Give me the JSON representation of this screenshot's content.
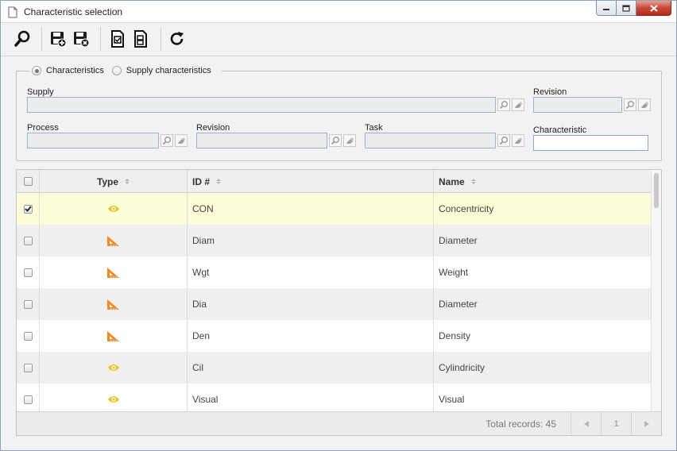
{
  "window": {
    "title": "Characteristic selection",
    "controls": {
      "minimize_icon": "minimize-icon",
      "maximize_icon": "maximize-icon",
      "close_icon": "close-icon"
    }
  },
  "toolbar": {
    "buttons": [
      {
        "name": "search-button",
        "icon": "magnifier-icon"
      },
      {
        "name": "save-add-button",
        "icon": "save-plus-icon"
      },
      {
        "name": "save-close-button",
        "icon": "save-close-icon"
      },
      {
        "name": "select-button",
        "icon": "doc-check-icon"
      },
      {
        "name": "select-all-button",
        "icon": "doc-list-icon"
      },
      {
        "name": "refresh-button",
        "icon": "refresh-icon"
      }
    ]
  },
  "filter": {
    "radio_characteristics": "Characteristics",
    "radio_supply": "Supply characteristics",
    "selected": "Characteristics",
    "supply_label": "Supply",
    "supply_value": "",
    "revision_label": "Revision",
    "revision_value": "",
    "process_label": "Process",
    "process_value": "",
    "process_revision_label": "Revision",
    "process_revision_value": "",
    "task_label": "Task",
    "task_value": "",
    "characteristic_label": "Characteristic",
    "characteristic_value": ""
  },
  "grid": {
    "columns": {
      "type": "Type",
      "id": "ID #",
      "name": "Name"
    },
    "rows": [
      {
        "checked": true,
        "type_icon": "eye-icon",
        "id": "CON",
        "name": "Concentricity"
      },
      {
        "checked": false,
        "type_icon": "set-square-icon",
        "id": "Diam",
        "name": "Diameter"
      },
      {
        "checked": false,
        "type_icon": "set-square-icon",
        "id": "Wgt",
        "name": "Weight"
      },
      {
        "checked": false,
        "type_icon": "set-square-icon",
        "id": "Dia",
        "name": "Diameter"
      },
      {
        "checked": false,
        "type_icon": "set-square-icon",
        "id": "Den",
        "name": "Density"
      },
      {
        "checked": false,
        "type_icon": "eye-icon",
        "id": "Cil",
        "name": "Cylindricity"
      },
      {
        "checked": false,
        "type_icon": "eye-icon",
        "id": "Visual",
        "name": "Visual"
      }
    ],
    "footer": {
      "total_label": "Total records: 45",
      "page": "1"
    }
  },
  "colors": {
    "eye_icon": "#e6c21c",
    "set_square_icon": "#f0892a",
    "selected_row": "#fdfdd7"
  }
}
